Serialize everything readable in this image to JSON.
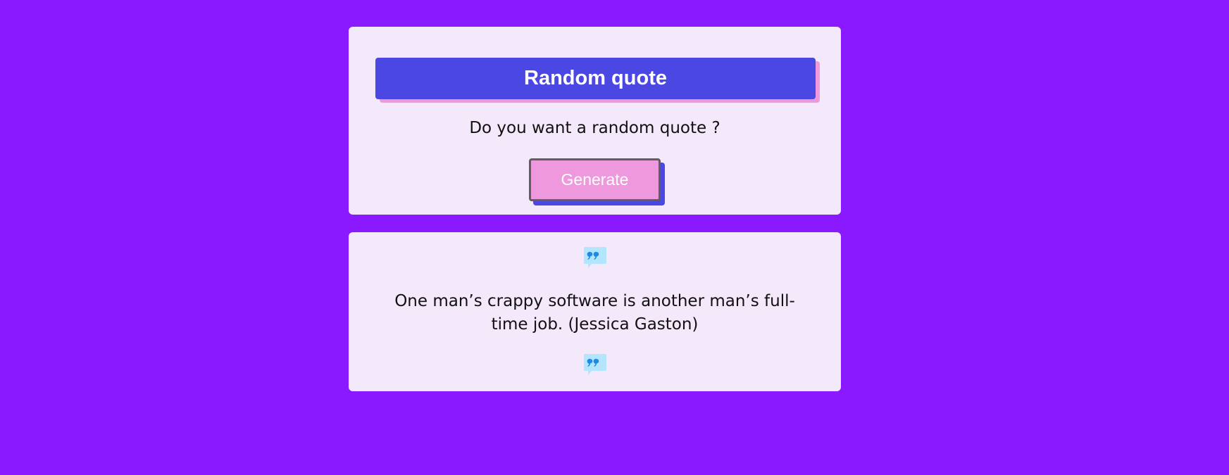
{
  "header": {
    "title": "Random quote"
  },
  "prompt": {
    "text": "Do you want a random quote ?"
  },
  "generate_button": {
    "label": "Generate"
  },
  "quote": {
    "text": "One man’s crappy software is another man’s full-time job. (Jessica Gaston)",
    "icon": "quote-bubble-icon"
  },
  "colors": {
    "background": "#8b19ff",
    "card": "#f4e8fb",
    "title_bar": "#4a47e3",
    "accent_pink": "#ee98dd",
    "icon_blue": "#1e88e5"
  }
}
